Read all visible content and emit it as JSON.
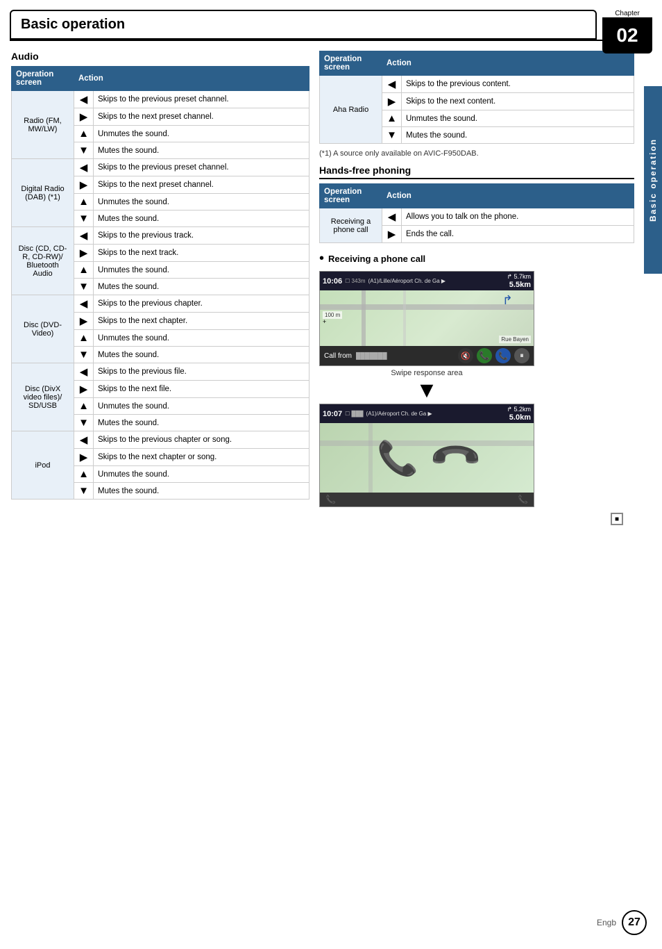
{
  "chapter": {
    "label": "Chapter",
    "number": "02"
  },
  "page_title": "Basic operation",
  "side_label": "Basic operation",
  "audio_section": {
    "title": "Audio",
    "table_headers": [
      "Operation screen",
      "Action"
    ],
    "rows": [
      {
        "screen": "Radio (FM, MW/LW)",
        "items": [
          {
            "arrow": "left",
            "text": "Skips to the previous preset channel."
          },
          {
            "arrow": "right",
            "text": "Skips to the next preset channel."
          },
          {
            "arrow": "up",
            "text": "Unmutes the sound."
          },
          {
            "arrow": "down",
            "text": "Mutes the sound."
          }
        ]
      },
      {
        "screen": "Digital Radio (DAB) (*1)",
        "items": [
          {
            "arrow": "left",
            "text": "Skips to the previous preset channel."
          },
          {
            "arrow": "right",
            "text": "Skips to the next preset channel."
          },
          {
            "arrow": "up",
            "text": "Unmutes the sound."
          },
          {
            "arrow": "down",
            "text": "Mutes the sound."
          }
        ]
      },
      {
        "screen": "Disc (CD, CD-R, CD-RW)/ Bluetooth Audio",
        "items": [
          {
            "arrow": "left",
            "text": "Skips to the previous track."
          },
          {
            "arrow": "right",
            "text": "Skips to the next track."
          },
          {
            "arrow": "up",
            "text": "Unmutes the sound."
          },
          {
            "arrow": "down",
            "text": "Mutes the sound."
          }
        ]
      },
      {
        "screen": "Disc (DVD-Video)",
        "items": [
          {
            "arrow": "left",
            "text": "Skips to the previous chapter."
          },
          {
            "arrow": "right",
            "text": "Skips to the next chapter."
          },
          {
            "arrow": "up",
            "text": "Unmutes the sound."
          },
          {
            "arrow": "down",
            "text": "Mutes the sound."
          }
        ]
      },
      {
        "screen": "Disc (DivX video files)/ SD/USB",
        "items": [
          {
            "arrow": "left",
            "text": "Skips to the previous file."
          },
          {
            "arrow": "right",
            "text": "Skips to the next file."
          },
          {
            "arrow": "up",
            "text": "Unmutes the sound."
          },
          {
            "arrow": "down",
            "text": "Mutes the sound."
          }
        ]
      },
      {
        "screen": "iPod",
        "items": [
          {
            "arrow": "left",
            "text": "Skips to the previous chapter or song."
          },
          {
            "arrow": "right",
            "text": "Skips to the next chapter or song."
          },
          {
            "arrow": "up",
            "text": "Unmutes the sound."
          },
          {
            "arrow": "down",
            "text": "Mutes the sound."
          }
        ]
      }
    ]
  },
  "aha_radio_section": {
    "screen_label": "Aha Radio",
    "table_headers": [
      "Operation screen",
      "Action"
    ],
    "items": [
      {
        "arrow": "left",
        "text": "Skips to the previous content."
      },
      {
        "arrow": "right",
        "text": "Skips to the next content."
      },
      {
        "arrow": "up",
        "text": "Unmutes the sound."
      },
      {
        "arrow": "down",
        "text": "Mutes the sound."
      }
    ]
  },
  "note": "(*1) A source only available on AVIC-F950DAB.",
  "hands_free_section": {
    "title": "Hands-free phoning",
    "table_headers": [
      "Operation screen",
      "Action"
    ],
    "rows": [
      {
        "screen": "Receiving a phone call",
        "items": [
          {
            "arrow": "left",
            "text": "Allows you to talk on the phone."
          },
          {
            "arrow": "right",
            "text": "Ends the call."
          }
        ]
      }
    ]
  },
  "phone_call": {
    "bullet_label": "Receiving a phone call",
    "map1": {
      "time": "10:06",
      "road": "(A1)/Lille/Aéroport Ch. de Ga ▶",
      "dist1": "5.7km",
      "dist2": "5.5km",
      "dist_badge": "343m",
      "call_from": "Call from",
      "caller": "...",
      "buttons": [
        "📞",
        "🔇",
        "📞",
        "⏸"
      ]
    },
    "swipe_label": "Swipe response area",
    "map2": {
      "time": "10:07",
      "road": "(A1)/Aéroport Ch. de Ga ▶",
      "dist1": "5.2km",
      "dist2": "5.0km"
    }
  },
  "footer": {
    "engb": "Engb",
    "page_num": "27",
    "stop_icon": "■"
  }
}
